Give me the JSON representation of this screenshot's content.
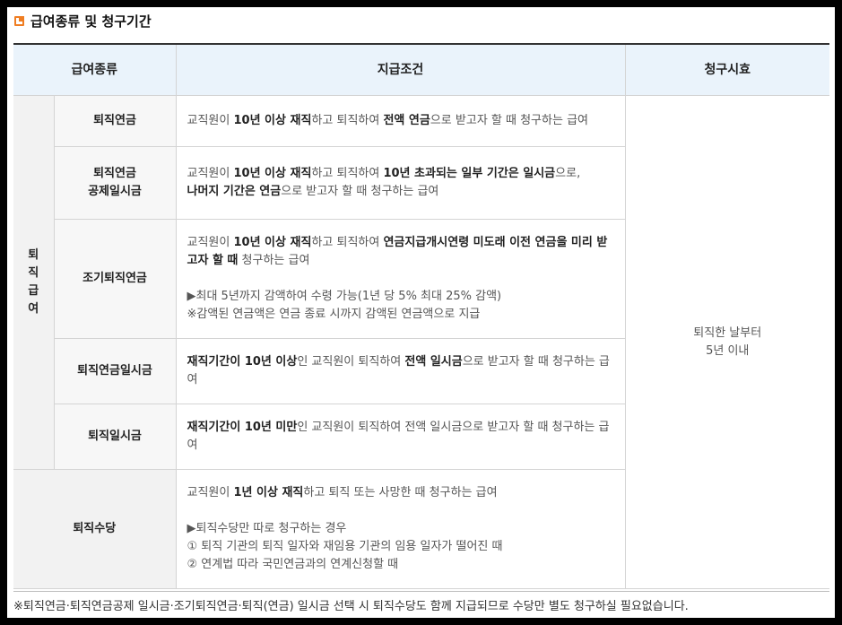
{
  "heading": {
    "title": "급여종류 및 청구기간",
    "icon": "title-square-icon"
  },
  "colors": {
    "accent": "#ef7d22",
    "header_bg": "#eaf3fb",
    "group_bg": "#f2f2f2"
  },
  "table": {
    "headers": [
      "급여종류",
      "지급조건",
      "청구시효"
    ],
    "group_label": [
      "퇴",
      "직",
      "급",
      "여"
    ],
    "period_line1": "퇴직한 날부터",
    "period_line2": "5년 이내",
    "rows": [
      {
        "type": "퇴직연금",
        "parts": [
          "교직원이 ",
          "10년 이상 재직",
          "하고 퇴직하여 ",
          "전액 연금",
          "으로 받고자 할 때 청구하는 급여"
        ]
      },
      {
        "type_line1": "퇴직연금",
        "type_line2": "공제일시금",
        "parts": [
          "교직원이 ",
          "10년 이상 재직",
          "하고 퇴직하여 ",
          "10년 초과되는 일부 기간은 일시금",
          "으로,"
        ],
        "parts2": [
          "나머지 기간은 연금",
          "으로 받고자 할 때 청구하는 급여"
        ]
      },
      {
        "type": "조기퇴직연금",
        "parts": [
          "교직원이 ",
          "10년 이상 재직",
          "하고 퇴직하여 ",
          "연금지급개시연령 미도래 이전 연금을 미리 받고자 할 때",
          " 청구하는 급여"
        ],
        "note1": "▶최대 5년까지 감액하여 수령 가능(1년 당 5% 최대 25% 감액)",
        "note2": "※감액된 연금액은 연금 종료 시까지 감액된 연금액으로 지급"
      },
      {
        "type": "퇴직연금일시금",
        "parts": [
          "재직기간이 10년 이상",
          "인 교직원이 퇴직하여 ",
          "전액 일시금",
          "으로 받고자 할 때 청구하는 급여"
        ]
      },
      {
        "type": "퇴직일시금",
        "parts": [
          "재직기간이 10년 미만",
          "인 교직원이 퇴직하여 전액 일시금으로 받고자 할 때 청구하는 급여"
        ]
      },
      {
        "type": "퇴직수당",
        "parts": [
          "교직원이 ",
          "1년 이상 재직",
          "하고 퇴직 또는 사망한 때 청구하는 급여"
        ],
        "note1": "▶퇴직수당만 따로 청구하는 경우",
        "note2": "① 퇴직 기관의 퇴직 일자와 재임용 기관의 임용 일자가 떨어진 때",
        "note3": "② 연계법 따라 국민연금과의 연계신청할 때"
      }
    ]
  },
  "footnote": "※퇴직연금·퇴직연금공제 일시금·조기퇴직연금·퇴직(연금) 일시금 선택 시 퇴직수당도 함께 지급되므로 수당만 별도 청구하실 필요없습니다."
}
